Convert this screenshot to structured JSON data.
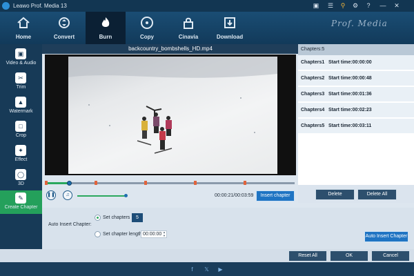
{
  "window": {
    "title": "Leawo Prof. Media 13",
    "titlebar_icons": [
      "cart-icon",
      "key-icon",
      "gear-icon",
      "help-icon",
      "minimize-icon",
      "close-icon"
    ]
  },
  "nav": {
    "items": [
      {
        "label": "Home",
        "icon": "home-icon"
      },
      {
        "label": "Convert",
        "icon": "convert-icon"
      },
      {
        "label": "Burn",
        "icon": "flame-icon",
        "active": true
      },
      {
        "label": "Copy",
        "icon": "disc-icon"
      },
      {
        "label": "Cinavia",
        "icon": "lock-icon"
      },
      {
        "label": "Download",
        "icon": "download-icon"
      }
    ],
    "brand": "Prof. Media"
  },
  "sidebar": {
    "items": [
      {
        "label": "Video & Audio",
        "icon": "video-icon"
      },
      {
        "label": "Trim",
        "icon": "scissors-icon"
      },
      {
        "label": "Watermark",
        "icon": "watermark-icon"
      },
      {
        "label": "Crop",
        "icon": "crop-icon"
      },
      {
        "label": "Effect",
        "icon": "effect-icon"
      },
      {
        "label": "3D",
        "icon": "glasses-3d-icon"
      },
      {
        "label": "Create Chapter",
        "icon": "chapter-icon",
        "active": true
      }
    ]
  },
  "editor": {
    "filename": "backcountry_bombshells_HD.mp4",
    "time_display": "00:00:21/00:03:59",
    "insert_chapter_label": "Insert chapter",
    "playback_progress": 0.09,
    "volume_level": 0.95
  },
  "auto_insert": {
    "label": "Auto Insert Chapter:",
    "set_chapters_label": "Set chapters",
    "set_chapters_value": "5",
    "set_length_label": "Set chapter length",
    "set_length_value": "00:00:00",
    "button_label": "Auto Insert Chapter"
  },
  "chapters": {
    "header": "Chapters:5",
    "start_label": "Start time:",
    "items": [
      {
        "name": "Chapters1",
        "start": "00:00:00"
      },
      {
        "name": "Chapters2",
        "start": "00:00:48"
      },
      {
        "name": "Chapters3",
        "start": "00:01:36"
      },
      {
        "name": "Chapters4",
        "start": "00:02:23"
      },
      {
        "name": "Chapters5",
        "start": "00:03:11"
      }
    ],
    "delete_label": "Delete",
    "delete_all_label": "Delete All"
  },
  "footer": {
    "reset_label": "Reset All",
    "ok_label": "OK",
    "cancel_label": "Cancel",
    "social_icons": [
      "facebook-icon",
      "x-twitter-icon",
      "youtube-icon"
    ]
  },
  "colors": {
    "accent_green": "#24a05b",
    "button_blue": "#1f74c3",
    "nav_dark": "#123a5a"
  }
}
